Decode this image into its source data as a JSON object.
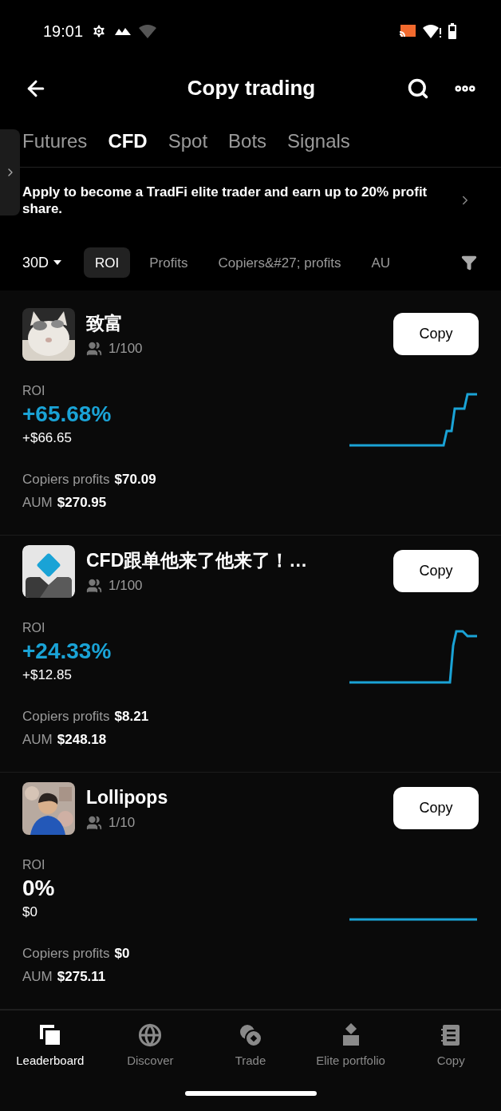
{
  "status_bar": {
    "time": "19:01"
  },
  "header": {
    "title": "Copy trading"
  },
  "tabs": [
    {
      "label": "Futures",
      "selected": false
    },
    {
      "label": "CFD",
      "selected": true
    },
    {
      "label": "Spot",
      "selected": false
    },
    {
      "label": "Bots",
      "selected": false
    },
    {
      "label": "Signals",
      "selected": false
    }
  ],
  "banner": {
    "text": "Apply to become a TradFi elite trader and earn up to 20% profit share."
  },
  "filters": {
    "period": "30D",
    "sorts": [
      {
        "label": "ROI",
        "selected": true
      },
      {
        "label": "Profits",
        "selected": false
      },
      {
        "label": "Copiers&#27; profits",
        "selected": false
      },
      {
        "label": "AU",
        "selected": false
      }
    ]
  },
  "traders": [
    {
      "name": "致富",
      "copiers": "1/100",
      "button": "Copy",
      "roi_label": "ROI",
      "roi": "+65.68%",
      "positive": true,
      "pnl": "+$66.65",
      "copiers_profits_label": "Copiers profits",
      "copiers_profits": "$70.09",
      "aum_label": "AUM",
      "aum": "$270.95",
      "sparkline": {
        "kind": "steps"
      }
    },
    {
      "name": "CFD跟单他来了他来了！…",
      "avatar": {
        "kind": "default"
      },
      "copiers": "1/100",
      "button": "Copy",
      "roi_label": "ROI",
      "roi": "+24.33%",
      "positive": true,
      "pnl": "+$12.85",
      "copiers_profits_label": "Copiers profits",
      "copiers_profits": "$8.21",
      "aum_label": "AUM",
      "aum": "$248.18",
      "sparkline": {
        "kind": "jump"
      }
    },
    {
      "name": "Lollipops",
      "copiers": "1/10",
      "button": "Copy",
      "roi_label": "ROI",
      "roi": "0%",
      "positive": false,
      "pnl": "$0",
      "copiers_profits_label": "Copiers profits",
      "copiers_profits": "$0",
      "aum_label": "AUM",
      "aum": "$275.11",
      "sparkline": {
        "kind": "flat"
      }
    }
  ],
  "bottom_nav": [
    {
      "label": "Leaderboard",
      "selected": true
    },
    {
      "label": "Discover",
      "selected": false
    },
    {
      "label": "Trade",
      "selected": false
    },
    {
      "label": "Elite portfolio",
      "selected": false
    },
    {
      "label": "Copy",
      "selected": false
    }
  ]
}
